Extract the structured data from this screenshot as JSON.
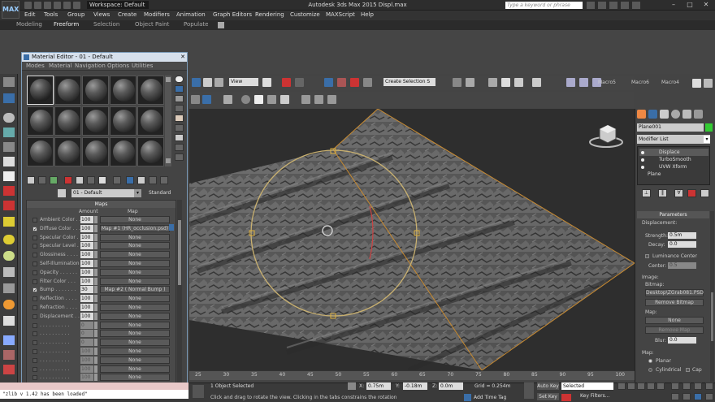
{
  "titlebar": {
    "logo": "MAX",
    "workspace": "Workspace: Default",
    "doc_title": "Autodesk 3ds Max 2015     Displ.max",
    "help_search_placeholder": "Type a keyword or phrase"
  },
  "menu": [
    "Edit",
    "Tools",
    "Group",
    "Views",
    "Create",
    "Modifiers",
    "Animation",
    "Graph Editors",
    "Rendering",
    "Customize",
    "MAXScript",
    "Help"
  ],
  "ribbon": [
    "Modeling",
    "Freeform",
    "Selection",
    "Object Paint",
    "Populate"
  ],
  "main_toolbar": {
    "view_dropdown": "View",
    "selection_set": "Create Selection S",
    "macros": [
      "Macro5",
      "Macro6",
      "Macro4"
    ]
  },
  "material_editor": {
    "title": "Material Editor - 01 - Default",
    "menu": [
      "Modes",
      "Material",
      "Navigation",
      "Options",
      "Utilities"
    ],
    "material_name": "01 - Default",
    "material_type": "Standard",
    "maps_title": "Maps",
    "col_amount": "Amount",
    "col_map": "Map",
    "maps": [
      {
        "label": "Ambient Color . .",
        "amount": "100",
        "map": "None",
        "checked": false
      },
      {
        "label": "Diffuse Color . . .",
        "amount": "100",
        "map": "Map #1 (HR_occlusion.psd)",
        "checked": true
      },
      {
        "label": "Specular Color . .",
        "amount": "100",
        "map": "None",
        "checked": false
      },
      {
        "label": "Specular Level . .",
        "amount": "100",
        "map": "None",
        "checked": false
      },
      {
        "label": "Glossiness . . . .",
        "amount": "100",
        "map": "None",
        "checked": false
      },
      {
        "label": "Self-Illumination .",
        "amount": "100",
        "map": "None",
        "checked": false
      },
      {
        "label": "Opacity . . . . . .",
        "amount": "100",
        "map": "None",
        "checked": false
      },
      {
        "label": "Filter Color . . .",
        "amount": "100",
        "map": "None",
        "checked": false
      },
      {
        "label": "Bump . . . . . . .",
        "amount": "30",
        "map": "Map #2 ( Normal Bump )",
        "checked": true
      },
      {
        "label": "Reflection . . . .",
        "amount": "100",
        "map": "None",
        "checked": false
      },
      {
        "label": "Refraction . . . .",
        "amount": "100",
        "map": "None",
        "checked": false
      },
      {
        "label": "Displacement . . .",
        "amount": "100",
        "map": "None",
        "checked": false
      },
      {
        "label": ". . . . . . . . . .",
        "amount": "0",
        "map": "None",
        "checked": false
      },
      {
        "label": ". . . . . . . . . .",
        "amount": "0",
        "map": "None",
        "checked": false
      },
      {
        "label": ". . . . . . . . . .",
        "amount": "0",
        "map": "None",
        "checked": false
      },
      {
        "label": ". . . . . . . . . .",
        "amount": "100",
        "map": "None",
        "checked": false
      },
      {
        "label": ". . . . . . . . . .",
        "amount": "100",
        "map": "None",
        "checked": false
      },
      {
        "label": ". . . . . . . . . .",
        "amount": "100",
        "map": "None",
        "checked": false
      },
      {
        "label": ". . . . . . . . . .",
        "amount": "100",
        "map": "None",
        "checked": false
      }
    ]
  },
  "command_panel": {
    "object_name": "Plane001",
    "modifier_list": "Modifier List",
    "stack": [
      "Displace",
      "TurboSmooth",
      "UVW Xform",
      "Plane"
    ],
    "parameters_title": "Parameters",
    "displacement_label": "Displacement:",
    "strength_label": "Strength:",
    "strength": "0.5m",
    "decay_label": "Decay:",
    "decay": "0.0",
    "luminance_center": "Luminance Center",
    "center_label": "Center:",
    "center": "0.5",
    "image_label": "Image:",
    "bitmap_label": "Bitmap:",
    "bitmap_path": "Desktop\\ZGrab081.PSD",
    "remove_bitmap": "Remove Bitmap",
    "map_label": "Map:",
    "map_none": "None",
    "remove_map": "Remove Map",
    "blur_label": "Blur:",
    "blur": "0.0",
    "map_section": "Map:",
    "planar": "Planar",
    "cylindrical": "Cylindrical",
    "cap": "Cap"
  },
  "timeline": {
    "ticks": [
      "25",
      "30",
      "35",
      "40",
      "45",
      "50",
      "55",
      "60",
      "65",
      "70",
      "75",
      "80",
      "85",
      "90",
      "95",
      "100"
    ]
  },
  "status": {
    "maxscript": "\"zlib v 1.42 has been loaded\"",
    "selection": "1 Object Selected",
    "prompt": "Click and drag to rotate the view.  Clicking in the tabs constrains the rotation",
    "x_label": "X:",
    "x": "0.75m",
    "y_label": "Y:",
    "y": "-0.18m",
    "z_label": "Z:",
    "z": "0.0m",
    "grid": "Grid = 0.254m",
    "add_time_tag": "Add Time Tag",
    "auto_key": "Auto Key",
    "set_key": "Set Key",
    "selected": "Selected",
    "key_filters": "Key Filters..."
  }
}
